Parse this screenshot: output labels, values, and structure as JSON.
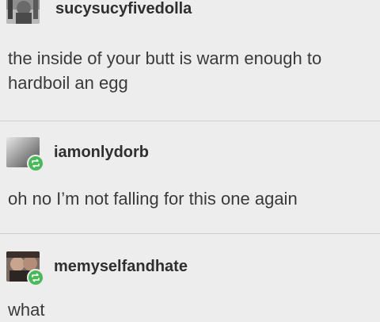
{
  "posts": [
    {
      "username": "sucysucyfivedolla",
      "body_lines": [
        "the inside of your butt is warm enough to",
        "hardboil an egg"
      ],
      "avatar_icon": "user-avatar",
      "is_reblog": false
    },
    {
      "username": "iamonlydorb",
      "body_lines": [
        "oh no I’m not falling for this one again"
      ],
      "avatar_icon": "user-avatar",
      "is_reblog": true,
      "badge_icon": "reblog-icon",
      "badge_color": "#4cb85c"
    },
    {
      "username": "memyselfandhate",
      "body_lines": [
        "what"
      ],
      "avatar_icon": "user-avatar",
      "is_reblog": true,
      "badge_icon": "reblog-icon",
      "badge_color": "#4cb85c"
    }
  ],
  "colors": {
    "background": "#ededed",
    "text": "#3a3a3a",
    "divider": "#d0d0d0"
  }
}
